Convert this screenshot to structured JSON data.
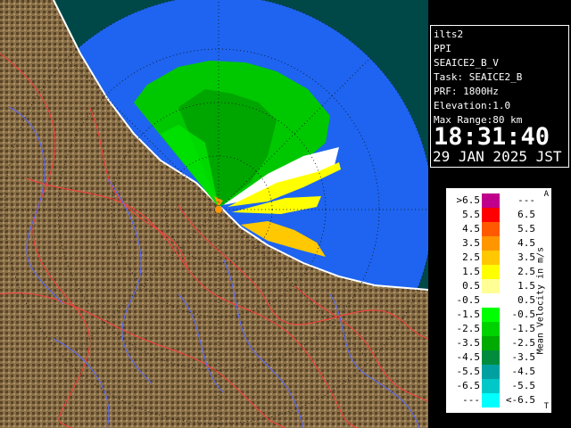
{
  "header": {
    "site": "ilts2",
    "product": "PPI",
    "volume": "SEAICE2_B_V",
    "task": "Task: SEAICE2_B",
    "prf": "PRF: 1800Hz",
    "elevation": "Elevation:1.0",
    "max_range": "Max Range:80 km",
    "time": "18:31:40",
    "date": "29 JAN 2025 JST"
  },
  "legend": {
    "title": "Mean Velocity in m/s",
    "top_mark": "A",
    "bottom_mark": "T",
    "rows": [
      {
        "lo": ">6.5",
        "hi": "---",
        "color": "#c0008c"
      },
      {
        "lo": "5.5",
        "hi": "6.5",
        "color": "#ff0000"
      },
      {
        "lo": "4.5",
        "hi": "5.5",
        "color": "#ff5a00"
      },
      {
        "lo": "3.5",
        "hi": "4.5",
        "color": "#ff9600"
      },
      {
        "lo": "2.5",
        "hi": "3.5",
        "color": "#ffc800"
      },
      {
        "lo": "1.5",
        "hi": "2.5",
        "color": "#ffff00"
      },
      {
        "lo": "0.5",
        "hi": "1.5",
        "color": "#ffff96"
      },
      {
        "lo": "-0.5",
        "hi": "0.5",
        "color": "#ffffff"
      },
      {
        "lo": "-1.5",
        "hi": "-0.5",
        "color": "#00ff00"
      },
      {
        "lo": "-2.5",
        "hi": "-1.5",
        "color": "#00d200"
      },
      {
        "lo": "-3.5",
        "hi": "-2.5",
        "color": "#00aa00"
      },
      {
        "lo": "-4.5",
        "hi": "-3.5",
        "color": "#008c3c"
      },
      {
        "lo": "-5.5",
        "hi": "-4.5",
        "color": "#00a0a0"
      },
      {
        "lo": "-6.5",
        "hi": "-5.5",
        "color": "#00c8c8"
      },
      {
        "lo": "---",
        "hi": "<-6.5",
        "color": "#00ffff"
      }
    ]
  },
  "map": {
    "ocean_color": "#1e64f0",
    "range_fill_color": "#1e64f0",
    "land_color": "#8a7048",
    "coast_color": "#ffffff",
    "river_color": "#4a5aff",
    "boundary_color": "#ff3c3c",
    "outside_color": "#003c3c"
  }
}
